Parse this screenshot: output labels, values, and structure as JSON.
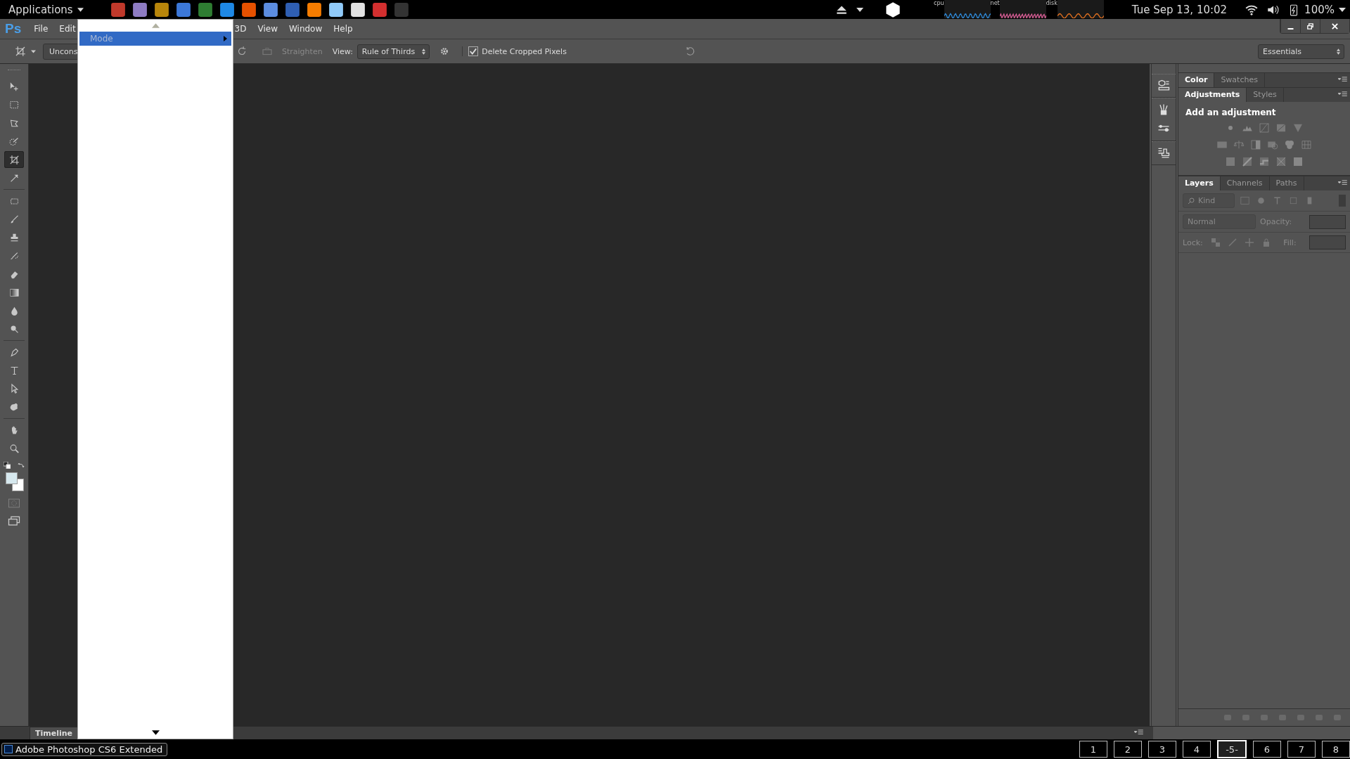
{
  "top_panel": {
    "applications": "Applications",
    "graphs": [
      {
        "label": "cpu"
      },
      {
        "label": "net"
      },
      {
        "label": "disk"
      }
    ],
    "clock": "Tue Sep 13, 10:02",
    "battery": "100%"
  },
  "menu_bar": {
    "logo": "Ps",
    "left_items": [
      "File",
      "Edit"
    ],
    "right_items": [
      "3D",
      "View",
      "Window",
      "Help"
    ]
  },
  "options_bar": {
    "preset": "Uncons",
    "straighten": "Straighten",
    "view_label": "View:",
    "view_value": "Rule of Thirds",
    "delete_cropped": {
      "label": "Delete Cropped Pixels",
      "checked": true
    },
    "workspace": "Essentials"
  },
  "dropdown": {
    "items": [
      {
        "label": "Mode",
        "selected": true,
        "submenu": true
      }
    ]
  },
  "tools": [
    {
      "kind": "move",
      "selected": false
    },
    {
      "kind": "marquee",
      "selected": false
    },
    {
      "kind": "lasso",
      "selected": false
    },
    {
      "kind": "quick",
      "selected": false
    },
    {
      "kind": "crop",
      "selected": true
    },
    {
      "kind": "eyedropper",
      "selected": false
    },
    {
      "kind": "heal",
      "selected": false
    },
    {
      "kind": "brush",
      "selected": false
    },
    {
      "kind": "stamp",
      "selected": false
    },
    {
      "kind": "history",
      "selected": false
    },
    {
      "kind": "eraser",
      "selected": false
    },
    {
      "kind": "gradient",
      "selected": false
    },
    {
      "kind": "blur",
      "selected": false
    },
    {
      "kind": "dodge",
      "selected": false
    },
    {
      "kind": "pen",
      "selected": false
    },
    {
      "kind": "type",
      "selected": false
    },
    {
      "kind": "pathselect",
      "selected": false
    },
    {
      "kind": "shape",
      "selected": false
    },
    {
      "kind": "hand",
      "selected": false
    },
    {
      "kind": "zoom",
      "selected": false
    }
  ],
  "panels": {
    "color_tabs": [
      {
        "label": "Color",
        "selected": true
      },
      {
        "label": "Swatches",
        "selected": false
      }
    ],
    "adjust_tabs": [
      {
        "label": "Adjustments",
        "selected": true
      },
      {
        "label": "Styles",
        "selected": false
      }
    ],
    "adjustment_heading": "Add an adjustment",
    "layers_tabs": [
      {
        "label": "Layers",
        "selected": true
      },
      {
        "label": "Channels",
        "selected": false
      },
      {
        "label": "Paths",
        "selected": false
      }
    ],
    "filter": "Kind",
    "blend_mode": "Normal",
    "opacity_label": "Opacity:",
    "lock_label": "Lock:",
    "fill_label": "Fill:"
  },
  "timeline_tab": "Timeline",
  "taskbar": {
    "task": "Adobe Photoshop CS6 Extended",
    "workspaces": [
      {
        "label": "1",
        "selected": false
      },
      {
        "label": "2",
        "selected": false
      },
      {
        "label": "3",
        "selected": false
      },
      {
        "label": "4",
        "selected": false
      },
      {
        "label": "-5-",
        "selected": true
      },
      {
        "label": "6",
        "selected": false
      },
      {
        "label": "7",
        "selected": false
      },
      {
        "label": "8",
        "selected": false
      }
    ]
  }
}
